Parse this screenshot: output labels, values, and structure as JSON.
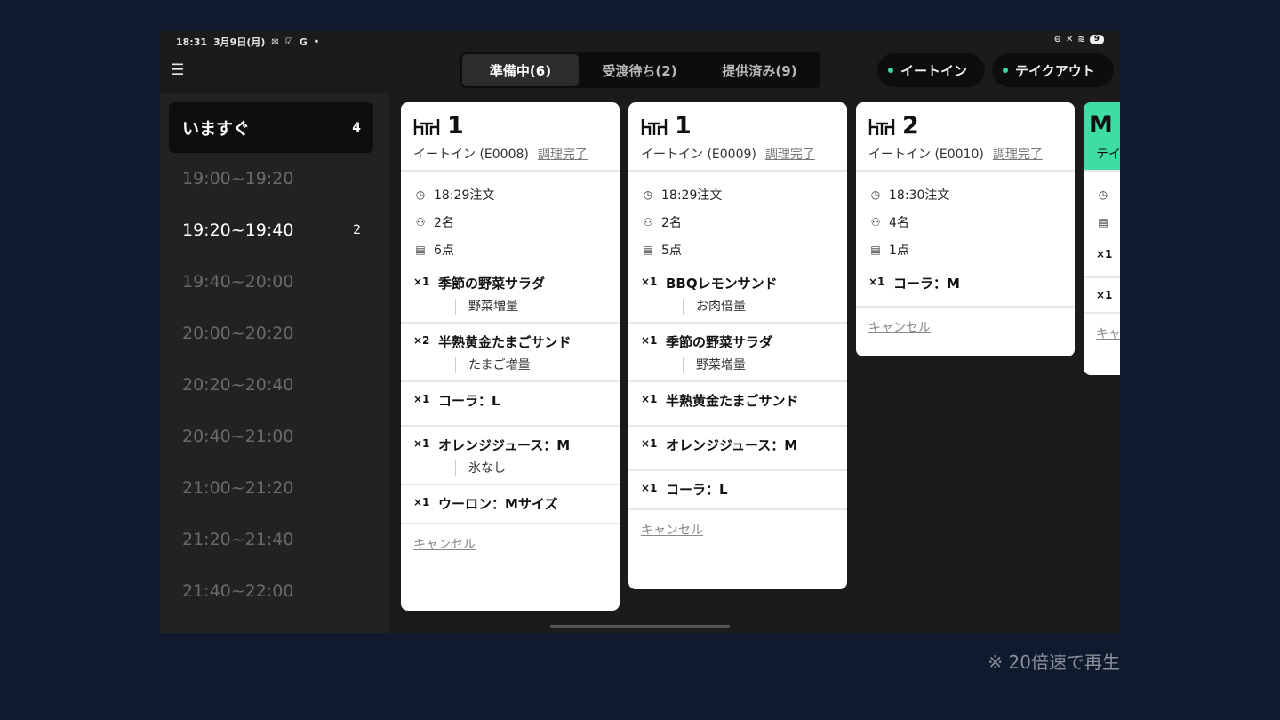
{
  "status": {
    "time": "18:31",
    "date": "3月9日(月)",
    "notify_g": "G",
    "battery": "9"
  },
  "tabs": [
    {
      "label": "準備中(6)"
    },
    {
      "label": "受渡待ち(2)"
    },
    {
      "label": "提供済み(9)"
    }
  ],
  "filters": {
    "eatin": "イートイン",
    "takeout": "テイクアウト"
  },
  "slots": [
    {
      "label": "いますぐ",
      "count": "4"
    },
    {
      "label": "19:00~19:20",
      "count": ""
    },
    {
      "label": "19:20~19:40",
      "count": "2"
    },
    {
      "label": "19:40~20:00",
      "count": ""
    },
    {
      "label": "20:00~20:20",
      "count": ""
    },
    {
      "label": "20:20~20:40",
      "count": ""
    },
    {
      "label": "20:40~21:00",
      "count": ""
    },
    {
      "label": "21:00~21:20",
      "count": ""
    },
    {
      "label": "21:20~21:40",
      "count": ""
    },
    {
      "label": "21:40~22:00",
      "count": ""
    }
  ],
  "cards": [
    {
      "table": "1",
      "order": "イートイン (E0008)",
      "done": "調理完了",
      "time": "18:29注文",
      "people": "2名",
      "items_count": "6点",
      "items": [
        {
          "qty": "×1",
          "name": "季節の野菜サラダ",
          "opt": "野菜増量"
        },
        {
          "qty": "×2",
          "name": "半熟黄金たまごサンド",
          "opt": "たまご増量"
        },
        {
          "qty": "×1",
          "name": "コーラ：L",
          "opt": ""
        },
        {
          "qty": "×1",
          "name": "オレンジジュース：M",
          "opt": "氷なし"
        },
        {
          "qty": "×1",
          "name": "ウーロン：Mサイズ",
          "opt": ""
        }
      ],
      "cancel": "キャンセル"
    },
    {
      "table": "1",
      "order": "イートイン (E0009)",
      "done": "調理完了",
      "time": "18:29注文",
      "people": "2名",
      "items_count": "5点",
      "items": [
        {
          "qty": "×1",
          "name": "BBQレモンサンド",
          "opt": "お肉倍量"
        },
        {
          "qty": "×1",
          "name": "季節の野菜サラダ",
          "opt": "野菜増量"
        },
        {
          "qty": "×1",
          "name": "半熟黄金たまごサンド",
          "opt": ""
        },
        {
          "qty": "×1",
          "name": "オレンジジュース：M",
          "opt": ""
        },
        {
          "qty": "×1",
          "name": "コーラ：L",
          "opt": ""
        }
      ],
      "cancel": "キャンセル"
    },
    {
      "table": "2",
      "order": "イートイン (E0010)",
      "done": "調理完了",
      "time": "18:30注文",
      "people": "4名",
      "items_count": "1点",
      "items": [
        {
          "qty": "×1",
          "name": "コーラ：M",
          "opt": ""
        }
      ],
      "cancel": "キャンセル"
    },
    {
      "table": "M",
      "order": "テイ",
      "qty1": "×1",
      "qty2": "×1",
      "cancel": "キャ"
    }
  ],
  "footnote": "※ 20倍速で再生",
  "colors": {
    "background": "#0f1a2e",
    "accent": "#3fdca4",
    "card": "#ffffff",
    "panel": "#1b1b1b"
  }
}
